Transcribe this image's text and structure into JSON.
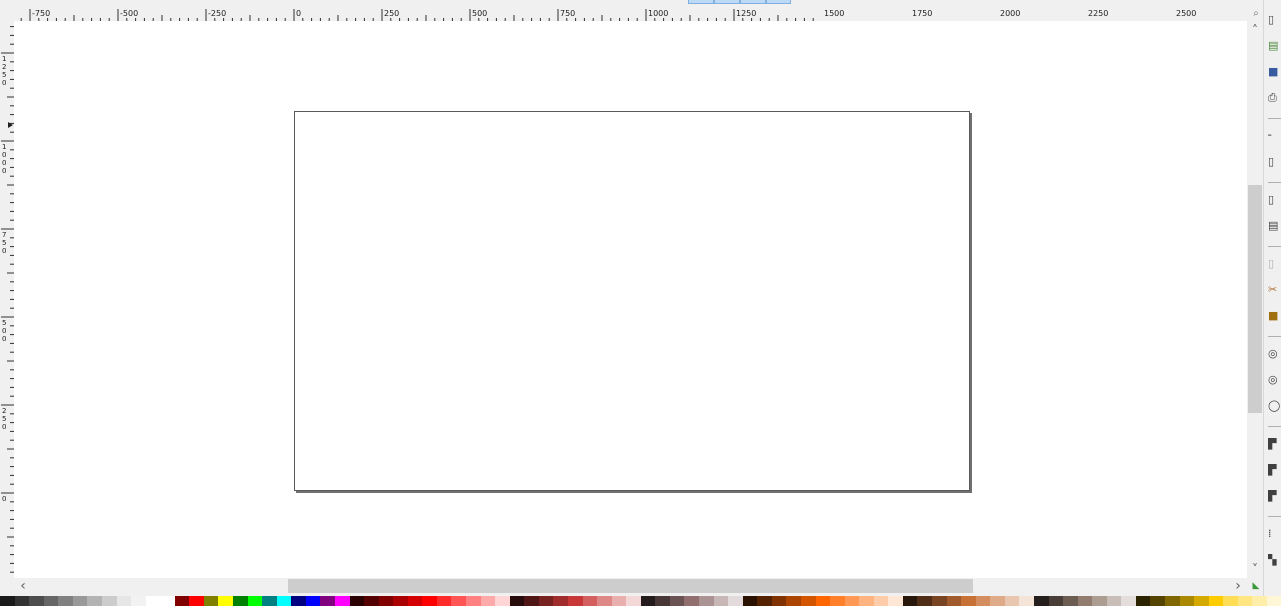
{
  "rulers": {
    "horizontal_labels": [
      "-750",
      "-500",
      "-250",
      "0",
      "250",
      "500",
      "750",
      "1000",
      "1250",
      "1500",
      "1750",
      "2000",
      "2250",
      "2500"
    ],
    "vertical_labels": [
      "1250",
      "1000",
      "750",
      "500",
      "250",
      "0"
    ]
  },
  "scroll": {
    "left_arrow": "‹",
    "right_arrow": "›",
    "up_arrow": "˄",
    "down_arrow": "˅"
  },
  "icons": {
    "zoom": "zoom-icon",
    "snap": "snap-toggle-icon"
  },
  "palette": [
    "#1a1a1a",
    "#333333",
    "#4d4d4d",
    "#666666",
    "#808080",
    "#999999",
    "#b3b3b3",
    "#cccccc",
    "#e6e6e6",
    "#f2f2f2",
    "#ffffff",
    "#ffffff",
    "#800000",
    "#ff0000",
    "#808000",
    "#ffff00",
    "#008000",
    "#00ff00",
    "#008080",
    "#00ffff",
    "#000080",
    "#0000ff",
    "#800080",
    "#ff00ff",
    "#2b0000",
    "#550000",
    "#800000",
    "#aa0000",
    "#d40000",
    "#ff0000",
    "#ff2a2a",
    "#ff5555",
    "#ff8080",
    "#ffaaaa",
    "#ffd5d5",
    "#280b0b",
    "#501616",
    "#782121",
    "#a02c2c",
    "#c83737",
    "#d35f5f",
    "#de8787",
    "#e9afaf",
    "#f4d7d7",
    "#241c1c",
    "#483737",
    "#6c5353",
    "#916f6f",
    "#ac9393",
    "#c8b7b7",
    "#e3dbdb",
    "#2b1100",
    "#552200",
    "#803300",
    "#aa4400",
    "#d45500",
    "#ff6600",
    "#ff7f2a",
    "#ff9955",
    "#ffb380",
    "#ffccaa",
    "#ffe6d5",
    "#28170b",
    "#502d16",
    "#784421",
    "#a05a2c",
    "#c87137",
    "#d38d5f",
    "#deaa87",
    "#e9c6af",
    "#f4e3d7",
    "#241f1c",
    "#483e37",
    "#6c5d53",
    "#917c6f",
    "#ac9d93",
    "#c8beb7",
    "#e3dedb",
    "#2b2200",
    "#554400",
    "#806600",
    "#aa8800",
    "#d4aa00",
    "#ffcc00",
    "#ffdd55",
    "#ffe680",
    "#ffeeaa",
    "#fff6d5"
  ]
}
